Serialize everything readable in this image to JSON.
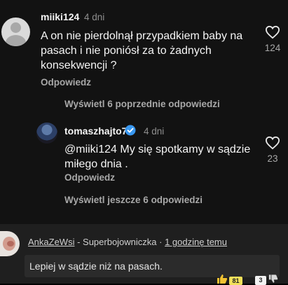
{
  "comment1": {
    "username": "miiki124",
    "age": "4 dni",
    "lines": [
      "A on nie pierdolnął przypadkiem baby na",
      "pasach i nie poniósł za to żadnych",
      "konsekwencji ?"
    ],
    "likes": "124",
    "reply_label": "Odpowiedz"
  },
  "view_previous_label": "Wyświetl 6 poprzednie odpowiedzi",
  "comment2": {
    "username": "tomaszhajto7",
    "age": "4 dni",
    "lines": [
      "@miiki124 My się spotkamy w sądzie",
      "miłego dnia ."
    ],
    "likes": "23",
    "reply_label": "Odpowiedz"
  },
  "view_more_label": "Wyświetl jeszcze 6 odpowiedzi",
  "yt_comment": {
    "username": "AnkaZeWsi",
    "separator1": " - Superbojowniczka · ",
    "time": "1 godzinę temu",
    "text": "Lepiej w sądzie niż na pasach.",
    "badge_likes": "81",
    "badge_other": "3"
  },
  "colors": {
    "background": "#121212",
    "verified": "#3897f0",
    "badge": "#f1e05a"
  },
  "icons": [
    "heart-icon",
    "verified-badge-icon",
    "thumbs-up-icon",
    "thumbs-down-icon"
  ]
}
